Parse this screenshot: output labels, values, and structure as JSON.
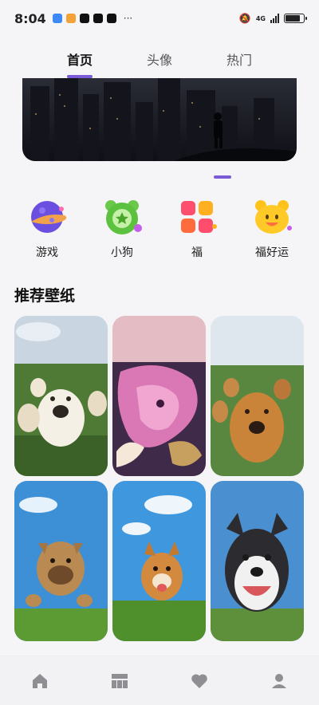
{
  "status": {
    "time": "8:04",
    "network": "4G",
    "more": "···"
  },
  "tabs": [
    {
      "label": "首页",
      "active": true
    },
    {
      "label": "头像",
      "active": false
    },
    {
      "label": "热门",
      "active": false
    }
  ],
  "categories": [
    {
      "label": "游戏",
      "icon": "planet-icon"
    },
    {
      "label": "小狗",
      "icon": "dog-star-icon"
    },
    {
      "label": "福",
      "icon": "grid-blocks-icon"
    },
    {
      "label": "福好运",
      "icon": "smiley-bear-icon"
    }
  ],
  "section": {
    "title": "推荐壁纸"
  },
  "wallpapers": [
    {
      "name": "dogs-group-selfie"
    },
    {
      "name": "pink-dragon"
    },
    {
      "name": "golden-retrievers-selfie"
    },
    {
      "name": "bulldog-jumping"
    },
    {
      "name": "corgi-running"
    },
    {
      "name": "husky-smiling"
    }
  ],
  "colors": {
    "accent": "#7b5cd6"
  },
  "bottom_nav": [
    {
      "icon": "home-icon"
    },
    {
      "icon": "category-grid-icon"
    },
    {
      "icon": "heart-icon"
    },
    {
      "icon": "profile-icon"
    }
  ]
}
